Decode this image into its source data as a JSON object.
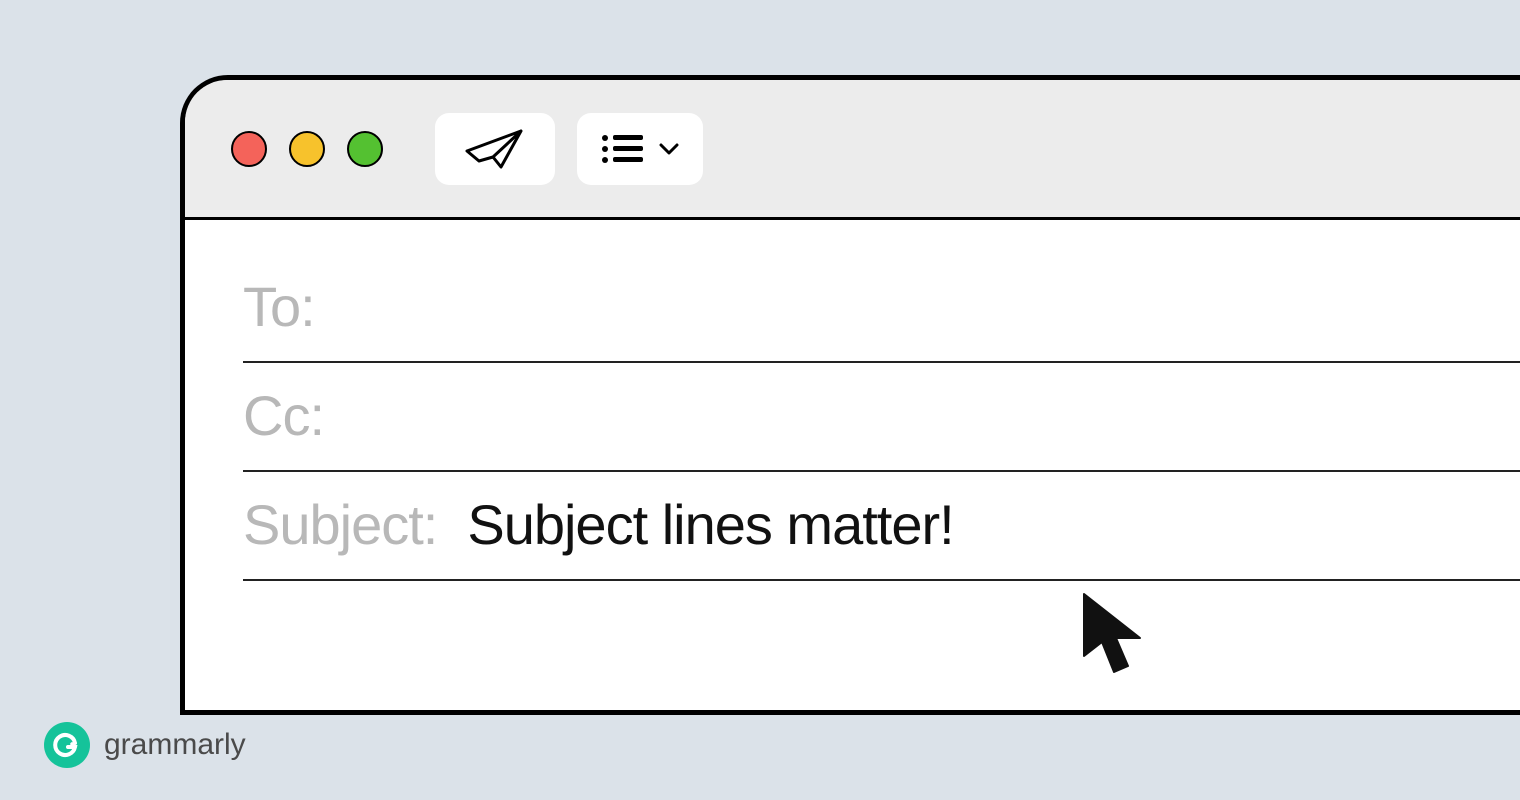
{
  "compose": {
    "to_label": "To:",
    "to_value": "",
    "cc_label": "Cc:",
    "cc_value": "",
    "subject_label": "Subject:",
    "subject_value": "Subject lines matter!"
  },
  "toolbar": {
    "window_controls": [
      "close",
      "minimize",
      "zoom"
    ],
    "send_icon": "paper-plane",
    "list_icon": "list",
    "dropdown_icon": "chevron-down"
  },
  "brand": {
    "name": "grammarly",
    "badge_letter": "G"
  },
  "colors": {
    "background": "#dbe2e9",
    "traffic_red": "#f4635a",
    "traffic_yellow": "#f7c22c",
    "traffic_green": "#54c131",
    "label_gray": "#b8b8b8",
    "brand_green": "#15c39a"
  }
}
